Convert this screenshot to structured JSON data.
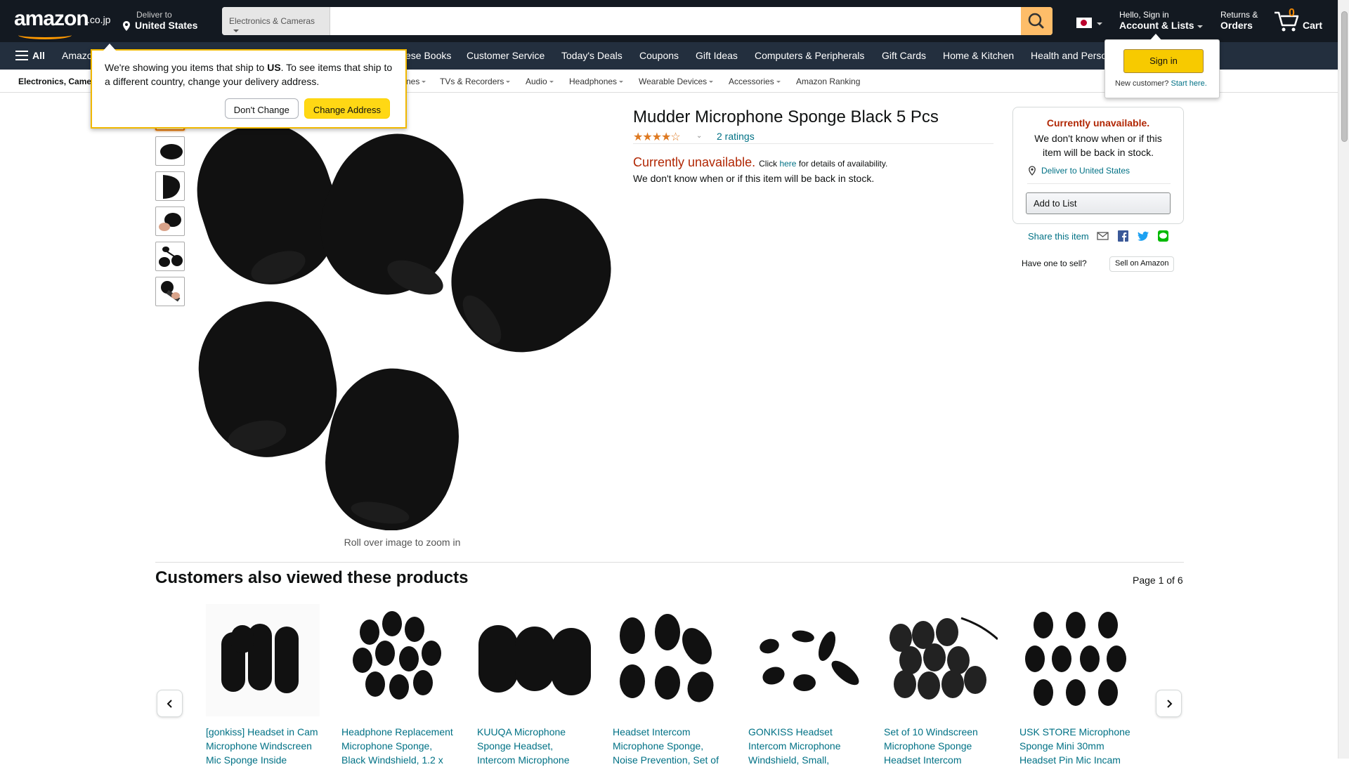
{
  "header": {
    "logo_word": "amazon",
    "logo_tld": ".co.jp",
    "deliver_to_line1": "Deliver to",
    "deliver_to_line2": "United States",
    "search_category": "Electronics & Cameras",
    "search_placeholder": "",
    "account_line1": "Hello, Sign in",
    "account_line2": "Account & Lists",
    "orders_line1": "Returns &",
    "orders_line2": "Orders",
    "cart_count": "0",
    "cart_label": "Cart"
  },
  "nav": {
    "all": "All",
    "items": [
      "Amazon",
      "ese Books",
      "Customer Service",
      "Today's Deals",
      "Coupons",
      "Gift Ideas",
      "Computers & Peripherals",
      "Gift Cards",
      "Home & Kitchen",
      "Health and Perso"
    ]
  },
  "subnav": {
    "first": "Electronics, Came",
    "items": [
      "nes",
      "TVs & Recorders",
      "Audio",
      "Headphones",
      "Wearable Devices",
      "Accessories",
      "Amazon Ranking"
    ]
  },
  "popover": {
    "text_pre": "We're showing you items that ship to ",
    "text_bold": "US",
    "text_post": ". To see items that ship to a different country, change your delivery address.",
    "dont_change": "Don't Change",
    "change_address": "Change Address"
  },
  "flyout": {
    "signin": "Sign in",
    "new_customer": "New customer?",
    "start_here": "Start here."
  },
  "product": {
    "title": "Mudder Microphone Sponge Black 5 Pcs",
    "stars": 4,
    "ratings": "2 ratings",
    "unavailable": "Currently unavailable.",
    "click": "Click",
    "here": "here",
    "details": "for details of availability.",
    "unknown": "We don't know when or if this item will be back in stock.",
    "rollover": "Roll over image to zoom in"
  },
  "buybox": {
    "unavailable": "Currently unavailable.",
    "unknown": "We don't know when or if this item will be back in stock.",
    "deliver": "Deliver to United States",
    "add_to_list": "Add to List",
    "share": "Share this item",
    "have_one": "Have one to sell?",
    "sell_on": "Sell on Amazon"
  },
  "carousel": {
    "heading": "Customers also viewed these products",
    "page": "Page 1 of 6",
    "items": [
      {
        "title": "[gonkiss] Headset in Cam Microphone Windscreen Mic Sponge Inside"
      },
      {
        "title": "Headphone Replacement Microphone Sponge, Black Windshield, 1.2 x"
      },
      {
        "title": "KUUQA Microphone Sponge Headset, Intercom Microphone"
      },
      {
        "title": "Headset Intercom Microphone Sponge, Noise Prevention, Set of"
      },
      {
        "title": "GONKISS Headset Intercom Microphone Windshield, Small,"
      },
      {
        "title": "Set of 10 Windscreen Microphone Sponge Headset Intercom"
      },
      {
        "title": "USK STORE Microphone Sponge Mini 30mm Headset Pin Mic Incam"
      }
    ]
  },
  "colors": {
    "header_bg": "#131921",
    "nav_bg": "#232f3e",
    "accent_orange": "#ff9900",
    "unavailable_red": "#b12704",
    "link_teal": "#007185",
    "button_yellow": "#ffd814"
  }
}
